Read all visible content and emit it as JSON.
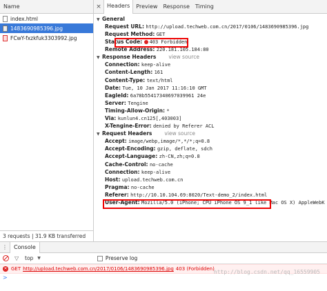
{
  "network": {
    "name_header": "Name",
    "files": [
      {
        "name": "index.html",
        "selected": false
      },
      {
        "name": "1483690985396.jpg",
        "selected": true
      },
      {
        "name": "FCwY-fxzkfuk3303992.jpg",
        "selected": false
      }
    ],
    "status": "3 requests | 31.9 KB transferred"
  },
  "tabs": {
    "close": "×",
    "items": [
      "Headers",
      "Preview",
      "Response",
      "Timing"
    ],
    "active": "Headers"
  },
  "general": {
    "title": "General",
    "rows": [
      {
        "k": "Request URL:",
        "v": "http://upload.techweb.com.cn/2017/0106/1483690985396.jpg"
      },
      {
        "k": "Request Method:",
        "v": "GET"
      },
      {
        "k": "Status Code:",
        "v": "403 Forbidden"
      },
      {
        "k": "Remote Address:",
        "v": "220.181.105.184:80"
      }
    ]
  },
  "response_headers": {
    "title": "Response Headers",
    "view_source": "view source",
    "rows": [
      {
        "k": "Connection:",
        "v": "keep-alive"
      },
      {
        "k": "Content-Length:",
        "v": "161"
      },
      {
        "k": "Content-Type:",
        "v": "text/html"
      },
      {
        "k": "Date:",
        "v": "Tue, 10 Jan 2017 11:16:10 GMT"
      },
      {
        "k": "EagleId:",
        "v": "6a78b55417340697039961 24e"
      },
      {
        "k": "Server:",
        "v": "Tengine"
      },
      {
        "k": "Timing-Allow-Origin:",
        "v": "*"
      },
      {
        "k": "Via:",
        "v": "kunlun4.cn125[,403003]"
      },
      {
        "k": "X-Tengine-Error:",
        "v": "denied by Referer ACL"
      }
    ]
  },
  "request_headers": {
    "title": "Request Headers",
    "view_source": "view source",
    "rows": [
      {
        "k": "Accept:",
        "v": "image/webp,image/*,*/*;q=0.8"
      },
      {
        "k": "Accept-Encoding:",
        "v": "gzip, deflate, sdch"
      },
      {
        "k": "Accept-Language:",
        "v": "zh-CN,zh;q=0.8"
      },
      {
        "k": "Cache-Control:",
        "v": "no-cache"
      },
      {
        "k": "Connection:",
        "v": "keep-alive"
      },
      {
        "k": "Host:",
        "v": "upload.techweb.com.cn"
      },
      {
        "k": "Pragma:",
        "v": "no-cache"
      },
      {
        "k": "Referer:",
        "v": "http://10.10.104.69:8020/Text-demo_2/index.html"
      },
      {
        "k": "User-Agent:",
        "v": "Mozilla/5.0 (iPhone; CPU iPhone OS 9_1 like Mac OS X) AppleWebK"
      }
    ]
  },
  "console": {
    "menu": "⋮",
    "tab": "Console",
    "context": "top",
    "preserve_log": "Preserve log",
    "error": {
      "method": "GET",
      "url": "http://upload.techweb.com.cn/2017/0106/1483690985396.jpg",
      "status": "403 (Forbidden)"
    },
    "prompt": ">",
    "watermark": "http://blog.csdn.net/qq_16559905"
  },
  "colors": {
    "accent": "#3879d9",
    "error": "#dd2222",
    "highlight_box": "#ee0000"
  }
}
